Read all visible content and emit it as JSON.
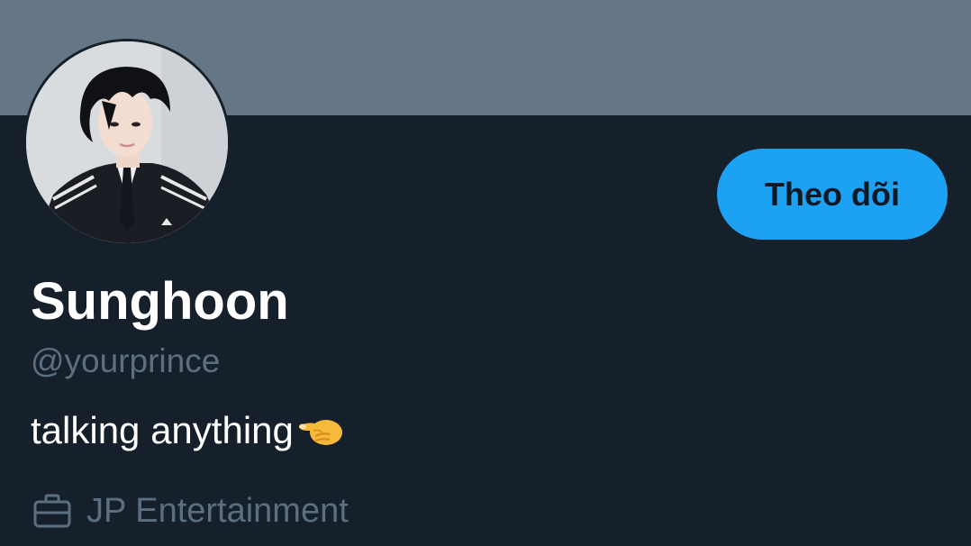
{
  "profile": {
    "display_name": "Sunghoon",
    "handle": "@yourprince",
    "bio_text": "talking anything",
    "bio_emoji": "pinching-hand-left-pointing",
    "work_icon": "briefcase-icon",
    "work_text": "JP Entertainment"
  },
  "actions": {
    "follow_label": "Theo dõi"
  },
  "colors": {
    "background": "#16202b",
    "banner": "#657786",
    "accent": "#1da1f2",
    "secondary_text": "#5c6f80",
    "primary_text": "#ffffff"
  }
}
